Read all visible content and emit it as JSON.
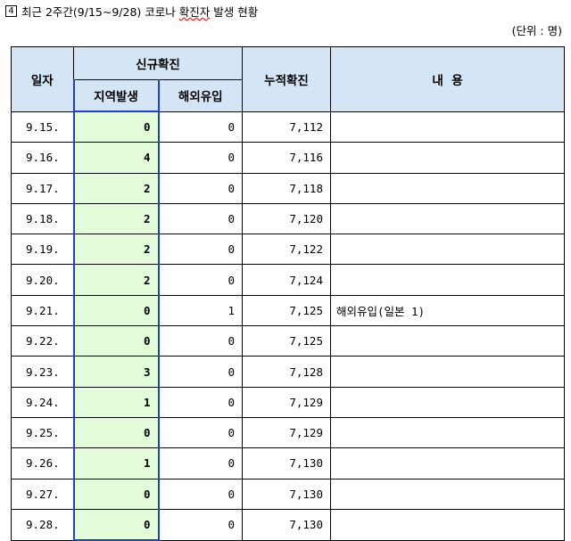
{
  "title": {
    "number": "4",
    "prefix": "최근 2주간(9/15~9/28) 코로나 ",
    "underlined": "확진자",
    "suffix": " 발생 현황"
  },
  "unit": "(단위 : 명)",
  "headers": {
    "date": "일자",
    "new_confirmed": "신규확진",
    "local": "지역발생",
    "imported": "해외유입",
    "cumulative": "누적확진",
    "content": "내  용"
  },
  "rows": [
    {
      "date": "9.15.",
      "local": "0",
      "imported": "0",
      "cumulative": "7,112",
      "note": ""
    },
    {
      "date": "9.16.",
      "local": "4",
      "imported": "0",
      "cumulative": "7,116",
      "note": ""
    },
    {
      "date": "9.17.",
      "local": "2",
      "imported": "0",
      "cumulative": "7,118",
      "note": ""
    },
    {
      "date": "9.18.",
      "local": "2",
      "imported": "0",
      "cumulative": "7,120",
      "note": ""
    },
    {
      "date": "9.19.",
      "local": "2",
      "imported": "0",
      "cumulative": "7,122",
      "note": ""
    },
    {
      "date": "9.20.",
      "local": "2",
      "imported": "0",
      "cumulative": "7,124",
      "note": ""
    },
    {
      "date": "9.21.",
      "local": "0",
      "imported": "1",
      "cumulative": "7,125",
      "note": "해외유입(일본 1)"
    },
    {
      "date": "9.22.",
      "local": "0",
      "imported": "0",
      "cumulative": "7,125",
      "note": ""
    },
    {
      "date": "9.23.",
      "local": "3",
      "imported": "0",
      "cumulative": "7,128",
      "note": ""
    },
    {
      "date": "9.24.",
      "local": "1",
      "imported": "0",
      "cumulative": "7,129",
      "note": ""
    },
    {
      "date": "9.25.",
      "local": "0",
      "imported": "0",
      "cumulative": "7,129",
      "note": ""
    },
    {
      "date": "9.26.",
      "local": "1",
      "imported": "0",
      "cumulative": "7,130",
      "note": ""
    },
    {
      "date": "9.27.",
      "local": "0",
      "imported": "0",
      "cumulative": "7,130",
      "note": ""
    },
    {
      "date": "9.28.",
      "local": "0",
      "imported": "0",
      "cumulative": "7,130",
      "note": ""
    }
  ]
}
